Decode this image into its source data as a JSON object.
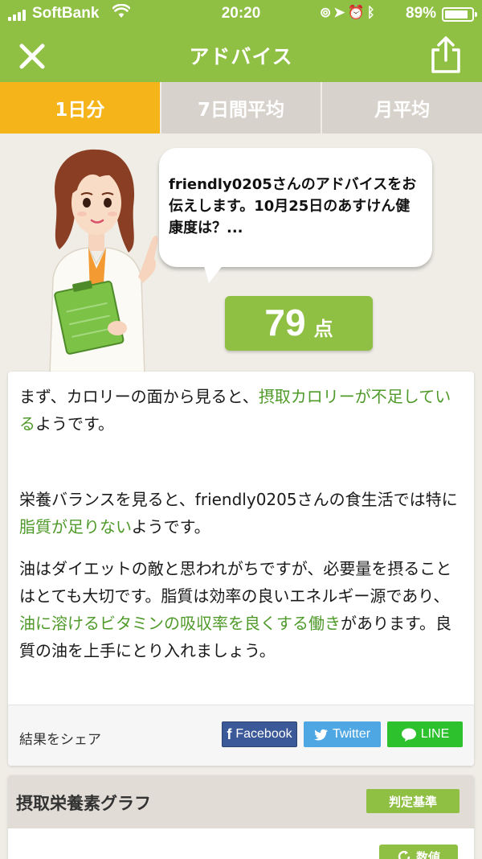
{
  "status_bar": {
    "carrier": "SoftBank",
    "time": "20:20",
    "battery_percent_text": "89%",
    "battery_level": 0.89,
    "icons": [
      "signal-icon",
      "wifi-icon",
      "orientation-lock-icon",
      "location-icon",
      "alarm-icon",
      "bluetooth-icon",
      "battery-icon"
    ]
  },
  "nav": {
    "title": "アドバイス",
    "left_icon": "close-icon",
    "right_icon": "share-icon"
  },
  "tabs": [
    {
      "label": "1日分",
      "active": true
    },
    {
      "label": "7日間平均",
      "active": false
    },
    {
      "label": "月平均",
      "active": false
    }
  ],
  "bubble": {
    "text": "friendly0205さんのアドバイスをお伝えします。10月25日のあすけん健康度は？..."
  },
  "score": {
    "value": "79",
    "unit": "点"
  },
  "advice": {
    "p1_a": "まず、カロリーの面から見ると、",
    "p1_hl": "摂取カロリーが不足している",
    "p1_b": "ようです。",
    "p2_a": "栄養バランスを見ると、friendly0205さんの食生活では特に",
    "p2_hl": "脂質が足りない",
    "p2_b": "ようです。",
    "p3_a": "油はダイエットの敵と思われがちですが、必要量を摂ることはとても大切です。脂質は効率の良いエネルギー源であり、",
    "p3_hl": "油に溶けるビタミンの吸収率を良くする働き",
    "p3_b": "があります。良質の油を上手にとり入れましょう。"
  },
  "share": {
    "label": "結果をシェア",
    "facebook": "Facebook",
    "twitter": "Twitter",
    "line": "LINE"
  },
  "graph": {
    "title": "摂取栄養素グラフ",
    "criteria_button": "判定基準",
    "value_button": "数値"
  },
  "colors": {
    "brand_green": "#8fbf43",
    "active_tab": "#f6b41b",
    "inactive_tab": "#d8d2cc",
    "highlight_text": "#4f9a2a",
    "facebook": "#3b5998",
    "twitter": "#4ea6e3",
    "line": "#2dc12d"
  }
}
